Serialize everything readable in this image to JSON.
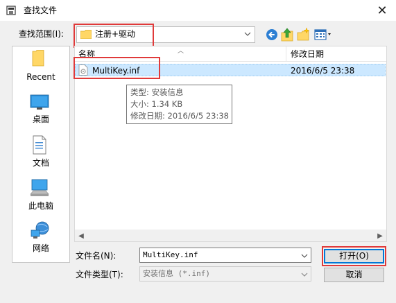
{
  "window": {
    "title": "查找文件",
    "close_glyph": "✕"
  },
  "lookin": {
    "label": "查找范围(I):",
    "value": "注册+驱动"
  },
  "toolbar": {
    "back_icon": "back-arrow-icon",
    "up_icon": "up-folder-icon",
    "new_folder_icon": "new-folder-icon",
    "views_icon": "views-menu-icon"
  },
  "places": [
    {
      "label": "Recent",
      "icon": "recent-folder-icon"
    },
    {
      "label": "桌面",
      "icon": "desktop-icon"
    },
    {
      "label": "文档",
      "icon": "documents-icon"
    },
    {
      "label": "此电脑",
      "icon": "computer-icon"
    },
    {
      "label": "网络",
      "icon": "network-icon"
    }
  ],
  "filelist": {
    "columns": [
      "名称",
      "修改日期"
    ],
    "rows": [
      {
        "name": "MultiKey.inf",
        "date": "2016/6/5 23:38",
        "selected": true
      }
    ]
  },
  "tooltip": {
    "line1": "类型: 安装信息",
    "line2": "大小: 1.34 KB",
    "line3": "修改日期: 2016/6/5 23:38"
  },
  "filename": {
    "label": "文件名(N):",
    "value": "MultiKey.inf"
  },
  "filetype": {
    "label": "文件类型(T):",
    "value": "安装信息 (*.inf)"
  },
  "buttons": {
    "open": "打开(O)",
    "cancel": "取消"
  },
  "colors": {
    "highlight_red": "#e03a3a",
    "selection": "#cce8ff",
    "focus_blue": "#0078d7",
    "dialog_bg": "#f0f0f0"
  }
}
